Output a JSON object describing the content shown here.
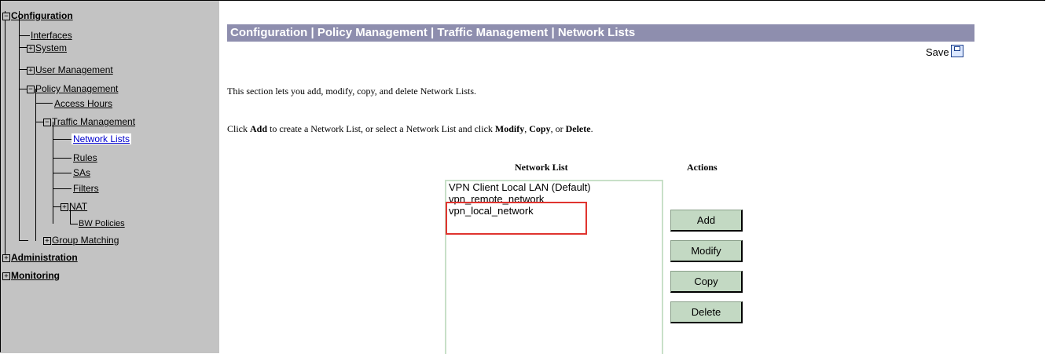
{
  "sidebar": {
    "items": [
      {
        "label": "Configuration",
        "expander": "−"
      },
      {
        "label": "Interfaces"
      },
      {
        "label": "System",
        "expander": "+"
      },
      {
        "label": "User Management",
        "expander": "+"
      },
      {
        "label": "Policy Management",
        "expander": "−"
      },
      {
        "label": "Access Hours"
      },
      {
        "label": "Traffic Management",
        "expander": "−"
      },
      {
        "label": "Network Lists"
      },
      {
        "label": "Rules"
      },
      {
        "label": "SAs"
      },
      {
        "label": "Filters"
      },
      {
        "label": "NAT",
        "expander": "+"
      },
      {
        "label": "BW Policies"
      },
      {
        "label": "Group Matching",
        "expander": "+"
      },
      {
        "label": "Administration",
        "expander": "+"
      },
      {
        "label": "Monitoring",
        "expander": "+"
      }
    ]
  },
  "header": {
    "title": "Configuration | Policy Management | Traffic Management | Network Lists",
    "save_label": "Save"
  },
  "intro": {
    "line1": "This section lets you add, modify, copy, and delete Network Lists.",
    "line2_pre": "Click ",
    "line2_add": "Add",
    "line2_mid": " to create a Network List, or select a Network List and click ",
    "line2_modify": "Modify",
    "line2_sep1": ", ",
    "line2_copy": "Copy",
    "line2_sep2": ", or ",
    "line2_delete": "Delete",
    "line2_end": "."
  },
  "network_list": {
    "heading": "Network List",
    "options": [
      "VPN Client Local LAN (Default)",
      "vpn_remote_network",
      "vpn_local_network"
    ]
  },
  "actions": {
    "heading": "Actions",
    "add": "Add",
    "modify": "Modify",
    "copy": "Copy",
    "delete": "Delete"
  },
  "colors": {
    "sidebar_bg": "#c3c3c3",
    "title_bar": "#8e8eae",
    "button_bg": "#c3d9c3",
    "highlight": "#e0342f"
  }
}
